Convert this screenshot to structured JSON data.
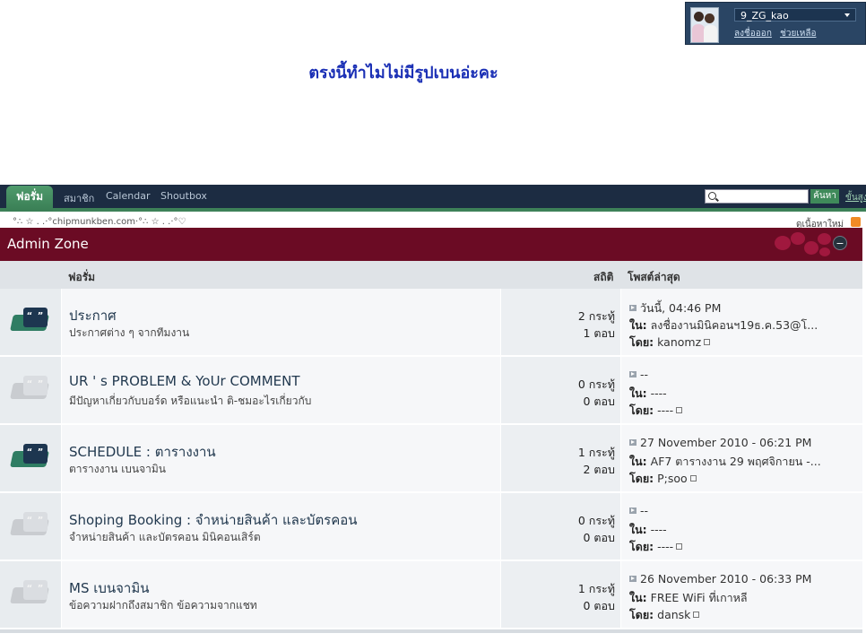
{
  "user": {
    "username": "9_ZG_kao",
    "logout": "ลงชื่อออก",
    "help": "ช่วยเหลือ"
  },
  "thread_title": "ตรงนี้ทำไมไม่มีรูปเบนอ่ะคะ",
  "navbar": {
    "tabs": [
      "ฟอรั่ม",
      "สมาชิก",
      "Calendar",
      "Shoutbox"
    ],
    "search_button": "ค้นหา",
    "advanced_search": "ขั้นสูง"
  },
  "subnav": {
    "breadcrumb": "°∴ ☆ . .·°chipmunkben.com·°∴ ☆ . .·°♡",
    "new_posts": "ดูเนื้อหาใหม่"
  },
  "category": {
    "title": "Admin Zone",
    "collapse": "−"
  },
  "columns": {
    "forum": "ฟอรั่ม",
    "stats": "สถิติ",
    "last_post": "โพสต์ล่าสุด"
  },
  "labels": {
    "in": "ใน:",
    "by": "โดย:"
  },
  "forums": [
    {
      "title": "ประกาศ",
      "description": "ประกาศต่าง ๆ จากทีมงาน",
      "threads": "2 กระทู้",
      "replies": "1 ตอบ",
      "last_date": "วันนี้, 04:46 PM",
      "last_in": "ลงชื่องานมินิคอนฯ19ธ.ค.53@โ...",
      "last_by": "kanomz",
      "status": "new"
    },
    {
      "title": "UR ' s PROBLEM & YoUr COMMENT",
      "description": "มีปัญหาเกี่ยวกับบอร์ด หรือแนะนำ ติ-ชมอะไรเกี่ยวกับ",
      "threads": "0 กระทู้",
      "replies": "0 ตอบ",
      "last_date": "--",
      "last_in": "----",
      "last_by": "----",
      "status": "old"
    },
    {
      "title": "SCHEDULE : ตารางงาน",
      "description": "ตารางงาน เบนจามิน",
      "threads": "1 กระทู้",
      "replies": "2 ตอบ",
      "last_date": "27 November 2010 - 06:21 PM",
      "last_in": "AF7 ตารางงาน 29 พฤศจิกายน -...",
      "last_by": "P;soo",
      "status": "new"
    },
    {
      "title": "Shoping Booking : จำหน่ายสินค้า และบัตรคอน",
      "description": "จำหน่ายสินค้า และบัตรคอน มินิคอนเสิร์ต",
      "threads": "0 กระทู้",
      "replies": "0 ตอบ",
      "last_date": "--",
      "last_in": "----",
      "last_by": "----",
      "status": "old"
    },
    {
      "title": "MS เบนจามิน",
      "description": "ข้อความฝากถึงสมาชิก ข้อความจากแชท",
      "threads": "1 กระทู้",
      "replies": "0 ตอบ",
      "last_date": "26 November 2010 - 06:33 PM",
      "last_in": "FREE WiFi ที่เกาหลี",
      "last_by": "dansk",
      "status": "old"
    }
  ],
  "colors": {
    "navbar": "#1c2c42",
    "accent_green": "#3d8158",
    "category_header": "#6b0b24",
    "title_blue": "#1a2fb5"
  }
}
